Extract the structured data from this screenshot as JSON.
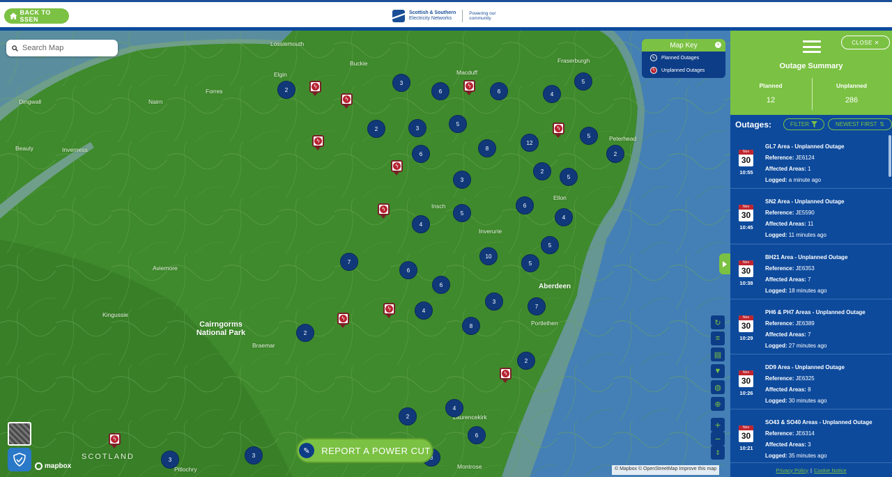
{
  "header": {
    "back_label": "BACK TO SSEN",
    "logo_line1": "Scottish & Southern",
    "logo_line2": "Electricity Networks",
    "tagline_line1": "Powering our",
    "tagline_line2": "community"
  },
  "map": {
    "search_placeholder": "Search Map",
    "report_label": "REPORT A POWER CUT",
    "mapbox_label": "mapbox",
    "attribution": "© Mapbox © OpenStreetMap  Improve this map",
    "map_key": {
      "title": "Map Key",
      "planned": "Planned Outages",
      "unplanned": "Unplanned Outages"
    },
    "places": {
      "lossiemouth": "Lossiemouth",
      "buckie": "Buckie",
      "fraserburgh": "Fraserburgh",
      "elgin": "Elgin",
      "macduff": "Macduff",
      "forres": "Forres",
      "nairn": "Nairn",
      "dingwall": "Dingwall",
      "peterhead": "Peterhead",
      "beauly": "Beauly",
      "inverness": "Inverness",
      "insch": "Insch",
      "ellon": "Ellon",
      "inverurie": "Inverurie",
      "aviemore": "Aviemore",
      "aberdeen": "Aberdeen",
      "kingussie": "Kingussie",
      "cairngorms": "Cairngorms National Park",
      "portlethen": "Portlethen",
      "braemar": "Braemar",
      "laurencekirk": "Laurencekirk",
      "montrose": "Montrose",
      "scotland": "SCOTLAND",
      "pitlochry": "Pitlochry"
    },
    "clusters": [
      "2",
      "3",
      "6",
      "6",
      "4",
      "5",
      "2",
      "3",
      "5",
      "6",
      "8",
      "12",
      "5",
      "2",
      "2",
      "5",
      "3",
      "5",
      "6",
      "4",
      "4",
      "5",
      "7",
      "6",
      "10",
      "5",
      "6",
      "3",
      "7",
      "4",
      "8",
      "2",
      "2",
      "4",
      "2",
      "6",
      "3",
      "3",
      "3"
    ]
  },
  "panel": {
    "close_label": "CLOSE",
    "summary_title": "Outage Summary",
    "planned_label": "Planned",
    "planned_count": "12",
    "unplanned_label": "Unplanned",
    "unplanned_count": "286",
    "outages_title": "Outages:",
    "filter_label": "FILTER",
    "sort_label": "NEWEST FIRST",
    "outages": [
      {
        "month": "Nov",
        "day": "30",
        "time": "10:55",
        "title": "GL7 Area - Unplanned Outage",
        "reference": "JE6124",
        "affected": "1",
        "logged": "a minute ago"
      },
      {
        "month": "Nov",
        "day": "30",
        "time": "10:45",
        "title": "SN2 Area - Unplanned Outage",
        "reference": "JE5590",
        "affected": "11",
        "logged": "11 minutes ago"
      },
      {
        "month": "Nov",
        "day": "30",
        "time": "10:38",
        "title": "BH21 Area - Unplanned Outage",
        "reference": "JE6353",
        "affected": "7",
        "logged": "18 minutes ago"
      },
      {
        "month": "Nov",
        "day": "30",
        "time": "10:29",
        "title": "PH6 & PH7 Areas - Unplanned Outage",
        "reference": "JE6389",
        "affected": "7",
        "logged": "27 minutes ago"
      },
      {
        "month": "Nov",
        "day": "30",
        "time": "10:26",
        "title": "DD9 Area - Unplanned Outage",
        "reference": "JE6325",
        "affected": "8",
        "logged": "30 minutes ago"
      },
      {
        "month": "Nov",
        "day": "30",
        "time": "10:21",
        "title": "SO43 & SO40 Areas - Unplanned Outage",
        "reference": "JE6314",
        "affected": "3",
        "logged": "35 minutes ago"
      }
    ],
    "labels": {
      "reference": "Reference:",
      "affected": "Affected Areas:",
      "logged": "Logged:"
    },
    "footer": {
      "privacy": "Privacy Policy",
      "separator": "|",
      "cookie": "Cookie Notice"
    }
  },
  "colors": {
    "brand_green": "#7bc143",
    "brand_blue": "#0d4a9c",
    "land": "#3f8a2c",
    "sea": "#447fb6",
    "outage_red": "#b72230"
  }
}
